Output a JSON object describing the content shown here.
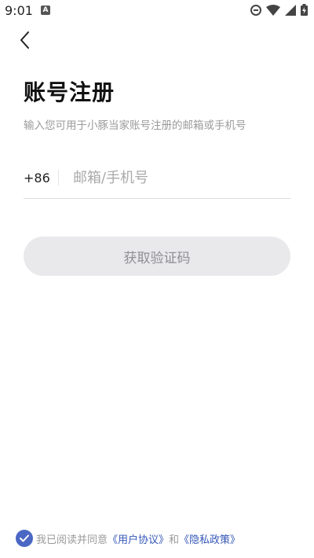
{
  "status_bar": {
    "time": "9:01",
    "notification_icon": "A"
  },
  "header": {
    "back_icon": "chevron-left-icon"
  },
  "title": "账号注册",
  "subtitle": "输入您可用于小豚当家账号注册的邮箱或手机号",
  "form": {
    "country_code": "+86",
    "account_placeholder": "邮箱/手机号",
    "account_value": ""
  },
  "buttons": {
    "get_code_label": "获取验证码"
  },
  "agreement": {
    "prefix": "我已阅读并同意",
    "user_agreement": "《用户协议》",
    "and": "和",
    "privacy_policy": "《隐私政策》",
    "checked": true
  },
  "colors": {
    "accent": "#4a67c4",
    "link": "#3557b8",
    "button_bg": "#e9e9ec",
    "button_text": "#8e8e93",
    "subtitle": "#9a9a9a"
  }
}
